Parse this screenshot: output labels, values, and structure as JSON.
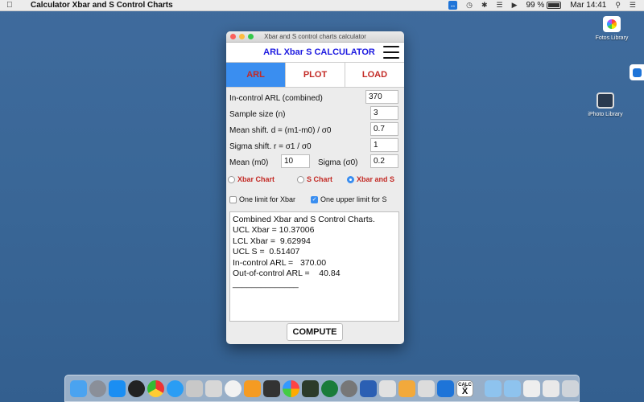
{
  "menubar": {
    "app_name": "Calculator Xbar and S Control Charts",
    "battery": "99 %",
    "clock": "Mar 14:41"
  },
  "desktop": {
    "icons": [
      {
        "label": "Fotos Library",
        "icon": "photos-library-icon"
      },
      {
        "label": "iPhoto Library",
        "icon": "iphoto-library-icon"
      }
    ]
  },
  "window": {
    "title": "Xbar and S control charts calculator",
    "header_title": "ARL Xbar S CALCULATOR",
    "tabs": [
      {
        "label": "ARL",
        "active": true
      },
      {
        "label": "PLOT",
        "active": false
      },
      {
        "label": "LOAD",
        "active": false
      }
    ],
    "fields": {
      "arl": {
        "label": "In-control ARL (combined)",
        "value": "370"
      },
      "n": {
        "label": "Sample size (n)",
        "value": "3"
      },
      "d": {
        "label": "Mean shift. d = (m1-m0) / σ0",
        "value": "0.7"
      },
      "r": {
        "label": "Sigma shift. r = σ1 / σ0",
        "value": "1"
      },
      "m0": {
        "label": "Mean (m0)",
        "value": "10"
      },
      "s0": {
        "label": "Sigma (σ0)",
        "value": "0.2"
      }
    },
    "chart_options": [
      {
        "label": "Xbar Chart",
        "selected": false
      },
      {
        "label": "S Chart",
        "selected": false
      },
      {
        "label": "Xbar and S",
        "selected": true
      }
    ],
    "limit_options": [
      {
        "label": "One limit for Xbar",
        "checked": false
      },
      {
        "label": "One upper limit for S",
        "checked": true
      }
    ],
    "output_lines": [
      "Combined Xbar and S Control Charts.",
      "UCL Xbar = 10.37006",
      "LCL Xbar =  9.62994",
      "UCL S =  0.51407",
      "In-control ARL =   370.00",
      "Out-of-control ARL =    40.84",
      "______________"
    ],
    "compute_label": "COMPUTE"
  },
  "colors": {
    "accent_blue": "#3a8ef0",
    "title_blue": "#1d1ae0",
    "label_red": "#c32a25"
  },
  "dock": {
    "calc_text": "CALC"
  }
}
